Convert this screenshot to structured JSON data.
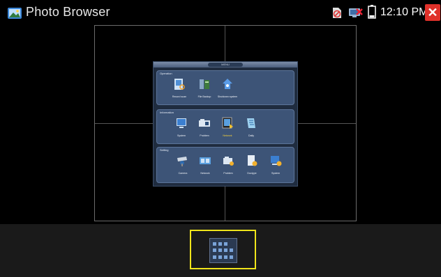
{
  "app": {
    "title": "Photo Browser",
    "icon": "photo-browser-icon"
  },
  "status": {
    "time": "12:10 PM",
    "icons": [
      "sd-card-disabled-icon",
      "network-disconnected-icon",
      "battery-icon"
    ]
  },
  "colors": {
    "close": "#e0312a",
    "selection": "#f0e51a",
    "menu_bg": "#1f2c3f",
    "group_bg": "#3d5477"
  },
  "photo": {
    "menu_title": "MENU",
    "groups": [
      {
        "label": "Operation",
        "items": [
          {
            "label": "Record scan",
            "icon": "record-scan-icon"
          },
          {
            "label": "File Backup",
            "icon": "file-backup-icon"
          },
          {
            "label": "Shutdown system",
            "icon": "shutdown-icon"
          }
        ]
      },
      {
        "label": "Information",
        "items": [
          {
            "label": "System",
            "icon": "system-icon"
          },
          {
            "label": "Problem",
            "icon": "problem-icon"
          },
          {
            "label": "Network",
            "icon": "network-icon",
            "selected": true
          },
          {
            "label": "Daily",
            "icon": "daily-icon"
          }
        ]
      },
      {
        "label": "Setting",
        "items": [
          {
            "label": "Camera",
            "icon": "camera-icon"
          },
          {
            "label": "Network",
            "icon": "network-setting-icon"
          },
          {
            "label": "Problem",
            "icon": "problem-setting-icon"
          },
          {
            "label": "Doctype",
            "icon": "doctype-icon"
          },
          {
            "label": "System",
            "icon": "system-setting-icon"
          }
        ]
      }
    ]
  }
}
